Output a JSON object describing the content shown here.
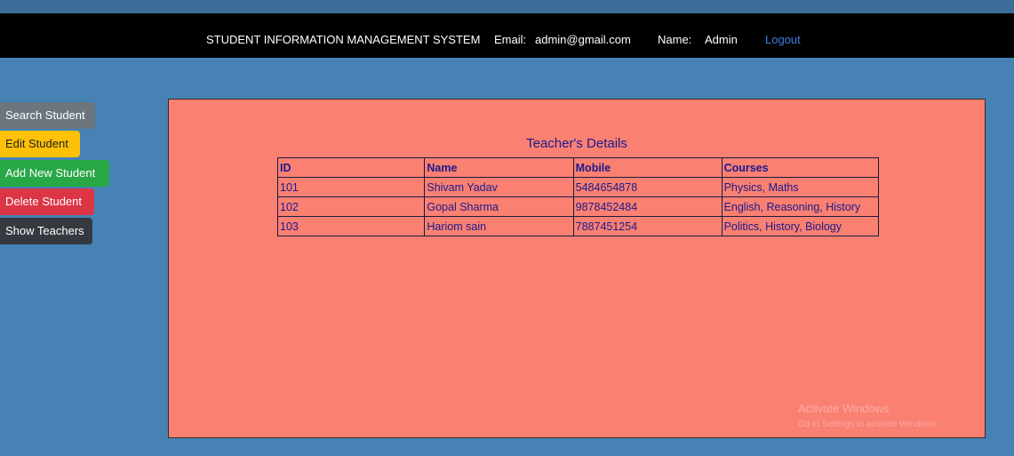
{
  "navbar": {
    "title": "STUDENT INFORMATION MANAGEMENT SYSTEM",
    "email_label": "Email:",
    "email_value": "admin@gmail.com",
    "name_label": "Name:",
    "name_value": "Admin",
    "logout": "Logout"
  },
  "sidebar": {
    "items": [
      {
        "label": "Search Student"
      },
      {
        "label": "Edit Student"
      },
      {
        "label": "Add New Student"
      },
      {
        "label": "Delete Student"
      },
      {
        "label": "Show Teachers"
      }
    ]
  },
  "panel": {
    "title": "Teacher's Details",
    "columns": [
      "ID",
      "Name",
      "Mobile",
      "Courses"
    ],
    "rows": [
      [
        "101",
        "Shivam Yadav",
        "5484654878",
        "Physics, Maths"
      ],
      [
        "102",
        "Gopal Sharma",
        "9878452484",
        "English, Reasoning, History"
      ],
      [
        "103",
        "Hariom sain",
        "7887451254",
        "Politics, History, Biology"
      ]
    ]
  },
  "watermark": {
    "title": "Activate Windows",
    "subtitle": "Go to Settings to activate Windows."
  },
  "colors": {
    "background": "#4682b4",
    "navbar": "#000000",
    "panel": "#fa8072",
    "text_accent": "#1a1a8c",
    "logout_link": "#3f7fe0"
  }
}
